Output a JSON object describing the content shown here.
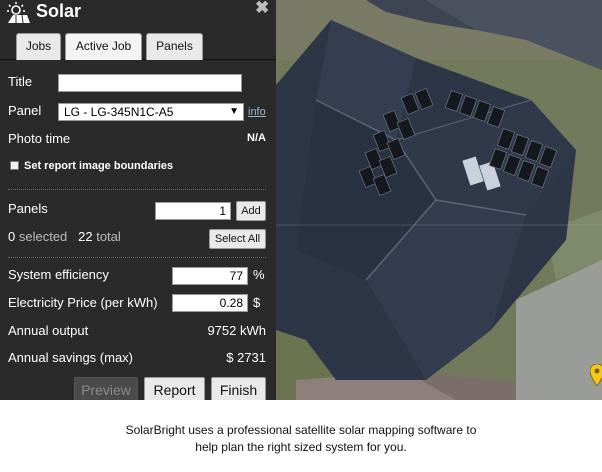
{
  "app": {
    "title": "Solar"
  },
  "tabs": [
    {
      "label": "Jobs"
    },
    {
      "label": "Active Job"
    },
    {
      "label": "Panels"
    }
  ],
  "job": {
    "title_label": "Title",
    "title_value": "",
    "panel_label": "Panel",
    "panel_selected": "LG - LG-345N1C-A5",
    "info_link": "info",
    "photo_time_label": "Photo time",
    "photo_time_value": "N/A",
    "report_boundaries_label": "Set report image boundaries"
  },
  "panels": {
    "label": "Panels",
    "add_count": "1",
    "add_button": "Add",
    "selected_count": "0",
    "selected_word": "selected",
    "total_count": "22",
    "total_word": "total",
    "select_all_button": "Select All"
  },
  "system": {
    "efficiency_label": "System efficiency",
    "efficiency_value": "77",
    "efficiency_unit": "%",
    "price_label": "Electricity Price (per kWh)",
    "price_value": "0.28",
    "price_unit": "$",
    "annual_output_label": "Annual output",
    "annual_output_value": "9752 kWh",
    "annual_savings_label": "Annual savings (max)",
    "annual_savings_value": "$ 2731"
  },
  "footer": {
    "preview_button": "Preview",
    "report_button": "Report",
    "finish_button": "Finish"
  },
  "caption": {
    "line1": "SolarBright uses a professional satellite solar mapping software to",
    "line2": "help plan the right sized system for you."
  },
  "colors": {
    "panel_bg": "#2a2a2a",
    "roof": "#2d3646",
    "solar_panel": "#15181d",
    "map_pin": "#f2c81e"
  }
}
